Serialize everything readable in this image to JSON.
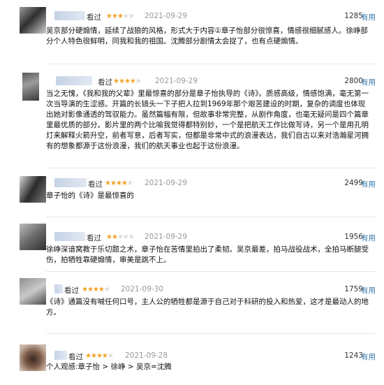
{
  "reviews": [
    {
      "seen_label": "看过",
      "rating": 3,
      "date": "2021-09-29",
      "votes": "1285",
      "useful_label": "有用",
      "text": "吴京部分硬煽情，延续了战狼的风格，形式大于内容①章子怡部分很惊喜，情感很细腻感人。徐峥部分个人特色很鲜明，同我和我的祖国。沈腾部分剧情太会捉了，也有点硬煽情。"
    },
    {
      "seen_label": "看过",
      "rating": 4,
      "date": "2021-09-29",
      "votes": "2800",
      "useful_label": "有用",
      "text": "当之无愧，《我和我的父辈》里最惊喜的部分是章子怡执导的《诗》。质感高级，情感饱满，毫无第一次当导演的生涩感。开篇的长镜头一下子把人拉到1969年那个艰苦建设的时期，复杂的调度也体现出她对影像通透的驾驭能力。虽然篇幅有限，但故事非常完整，从剧作角度，也毫无疑问是四个篇章里最优质的部分。影片里的两个比喻我觉得都特别妙，一个是把航天工作比做写诗，另一个是用孔明灯来解释火箭升空，前者写意，后者写实，但都是非常中式的浪漫表达，我们自古以来对浩瀚星河拥有的想象都源于这份浪漫，我们的航天事业也起于这份浪漫。"
    },
    {
      "seen_label": "看过",
      "rating": 4,
      "date": "2021-09-29",
      "votes": "2499",
      "useful_label": "有用",
      "text": "章子怡的《诗》是最惊喜的"
    },
    {
      "seen_label": "看过",
      "rating": 2,
      "date": "2021-09-29",
      "votes": "1956",
      "useful_label": "有用",
      "text": "徐峥深谙窝教于乐切题之术，章子怡在苦情里拍出了柔韧。吴京最差，拍马战役战术，全拍马断腿受伤，拍牺牲靠硬煽情，审美是跳不上。"
    },
    {
      "seen_label": "看过",
      "rating": 4,
      "date": "2021-09-30",
      "votes": "1759",
      "useful_label": "有用",
      "text": "《诗》通篇没有喊任何口号，主人公的牺牲都是源于自己对于科研的投入和热爱，这才是最动人的地方。"
    },
    {
      "seen_label": "看过",
      "rating": 4,
      "date": "2021-09-28",
      "votes": "1243",
      "useful_label": "有用",
      "text": "个人观感:章子怡 > 徐峥 > 吴京=沈腾"
    }
  ]
}
